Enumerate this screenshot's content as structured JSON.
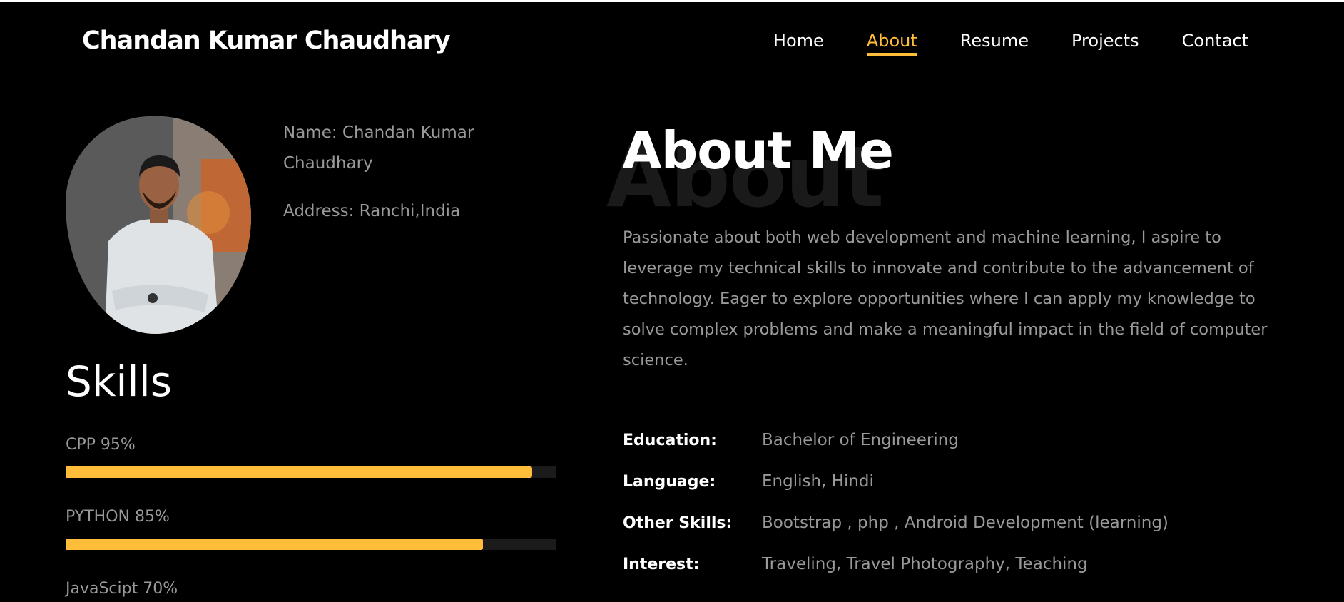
{
  "header": {
    "brand": "Chandan Kumar Chaudhary",
    "nav": [
      {
        "label": "Home",
        "active": false
      },
      {
        "label": "About",
        "active": true
      },
      {
        "label": "Resume",
        "active": false
      },
      {
        "label": "Projects",
        "active": false
      },
      {
        "label": "Contact",
        "active": false
      }
    ]
  },
  "profile": {
    "name_line": "Name: Chandan Kumar Chaudhary",
    "address_line": "Address: Ranchi,India"
  },
  "skills": {
    "title": "Skills",
    "items": [
      {
        "label": "CPP 95%",
        "level": 0.95
      },
      {
        "label": "PYTHON 85%",
        "level": 0.85
      },
      {
        "label": "JavaScipt 70%",
        "level": 0.7
      }
    ]
  },
  "about": {
    "background_word": "About",
    "title": "About Me",
    "text": "Passionate about both web development and machine learning, I aspire to leverage my technical skills to innovate and contribute to the advancement of technology. Eager to explore opportunities where I can apply my knowledge to solve complex problems and make a meaningful impact in the field of computer science.",
    "facts": [
      {
        "key": "Education:",
        "value": "Bachelor of Engineering"
      },
      {
        "key": "Language:",
        "value": "English, Hindi"
      },
      {
        "key": "Other Skills:",
        "value": "Bootstrap , php , Android Development (learning)"
      },
      {
        "key": "Interest:",
        "value": "Traveling, Travel Photography, Teaching"
      }
    ]
  },
  "colors": {
    "accent": "#ffbd39",
    "background": "#000000",
    "text_muted": "#999999"
  }
}
